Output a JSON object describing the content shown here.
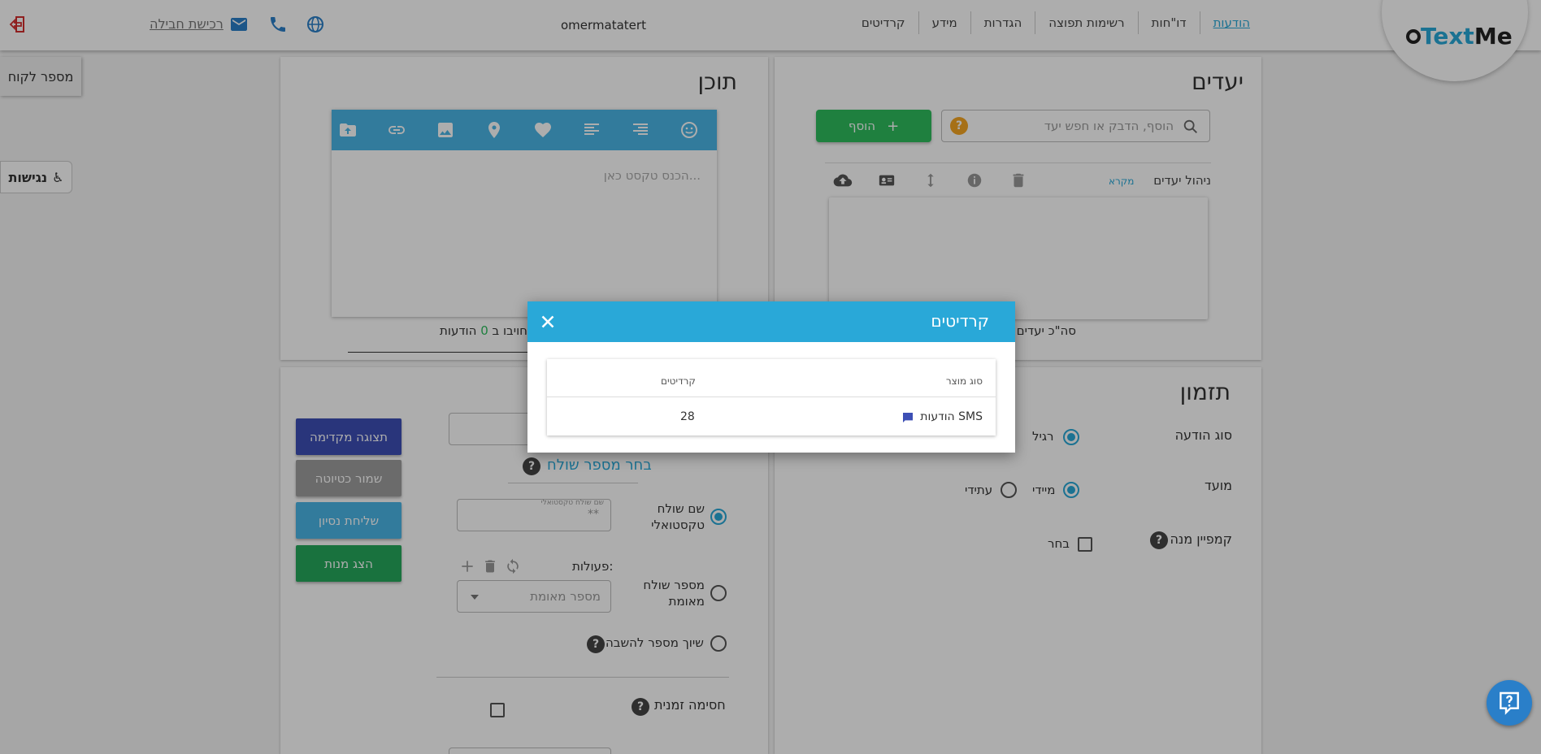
{
  "header": {
    "logo_main": "Text",
    "logo_tail": "Me",
    "nav": [
      "הודעות",
      "דו\"חות",
      "רשימות תפוצה",
      "הגדרות",
      "מידע",
      "קרדיטים"
    ],
    "user": "omermatatert",
    "purchase_link": "רכישת חבילה"
  },
  "side_tabs": {
    "customer_number": "מספר לקוח",
    "accessibility": "נגישות"
  },
  "targets": {
    "title": "יעדים",
    "search_placeholder": "הוסף, הדבק או חפש יעד",
    "add_button": "הוסף",
    "manage_label": "ניהול יעדים",
    "legend_link": "מקרא",
    "total_label": "סה\"כ יעדים"
  },
  "content": {
    "title": "תוכן",
    "editor_placeholder": "הכנס טקסט כאן...",
    "footer_prefix": "יחויבו ב",
    "footer_count": "0",
    "footer_suffix": "הודעות"
  },
  "schedule": {
    "title": "תזמון",
    "message_type_label": "סוג הודעה",
    "message_type_regular": "רגיל",
    "timing_label": "מועד",
    "timing_immediate": "מיידי",
    "timing_future": "עתידי",
    "campaign_label": "קמפיין מנה",
    "campaign_choose": "בחר"
  },
  "sending": {
    "choose_sender": "בחר מספר שולח",
    "text_sender_label": "שם שולח טקסטואלי",
    "text_sender_field_label": "שם שולח טקסטואלי",
    "text_sender_value": "**",
    "verified_sender_label": "מספר שולח מאומת",
    "actions_label": "פעולות:",
    "verified_placeholder": "מספר מאומת",
    "reply_number_label": "שיוך מספר להשבה",
    "time_block_label": "חסימה זמנית"
  },
  "side_buttons": {
    "preview": "תצוגה מקדימה",
    "save_draft": "שמור כטיוטה",
    "test_send": "שליחת נסיון",
    "show_batches": "הצג מנות"
  },
  "modal": {
    "title": "קרדיטים",
    "col_product": "סוג מוצר",
    "col_credits": "קרדיטים",
    "rows": [
      {
        "product": "הודעות SMS",
        "credits": "28"
      }
    ]
  },
  "colors": {
    "accent": "#29a8d8",
    "green": "#2ebd5e",
    "preview_btn": "#3d4fb5"
  }
}
